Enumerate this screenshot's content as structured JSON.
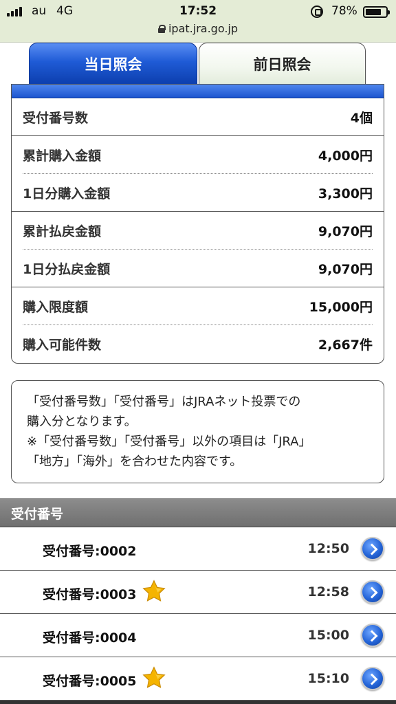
{
  "status_bar": {
    "carrier": "au",
    "network": "4G",
    "time": "17:52",
    "battery": "78%",
    "battery_level": 0.78,
    "url": "ipat.jra.go.jp"
  },
  "tabs": [
    {
      "label": "当日照会",
      "active": true
    },
    {
      "label": "前日照会",
      "active": false
    }
  ],
  "summary": [
    {
      "label": "受付番号数",
      "value": "4個"
    },
    {
      "label": "累計購入金額",
      "value": "4,000円"
    },
    {
      "label": "1日分購入金額",
      "value": "3,300円"
    },
    {
      "label": "累計払戻金額",
      "value": "9,070円"
    },
    {
      "label": "1日分払戻金額",
      "value": "9,070円"
    },
    {
      "label": "購入限度額",
      "value": "15,000円"
    },
    {
      "label": "購入可能件数",
      "value": "2,667件"
    }
  ],
  "note": {
    "line1": "「受付番号数」「受付番号」はJRAネット投票での",
    "line2": "購入分となります。",
    "line3": "※「受付番号数」「受付番号」以外の項目は「JRA」",
    "line4": "「地方」「海外」を合わせた内容です。"
  },
  "receipts": {
    "header": "受付番号",
    "items": [
      {
        "label": "受付番号:0002",
        "time": "12:50",
        "starred": false
      },
      {
        "label": "受付番号:0003",
        "time": "12:58",
        "starred": true
      },
      {
        "label": "受付番号:0004",
        "time": "15:00",
        "starred": false
      },
      {
        "label": "受付番号:0005",
        "time": "15:10",
        "starred": true
      }
    ]
  },
  "colors": {
    "accent_blue": "#1f5bd6",
    "status_bar_bg": "#e4ecd6",
    "star": "#f5b400"
  }
}
